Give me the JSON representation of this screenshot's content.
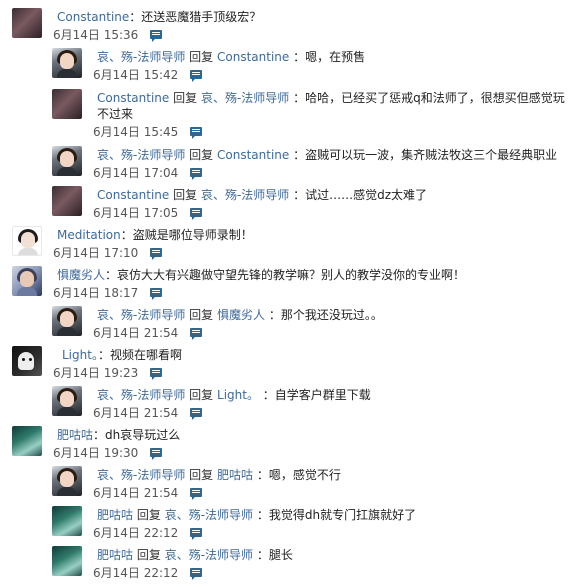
{
  "comments": [
    {
      "id": 0,
      "avatar": "constantine-avatar",
      "author": "Constantine",
      "reply_word": "",
      "reply_to": "",
      "text": "：还送恶魔猎手顶级宏？",
      "time": "6月14日 15:36"
    },
    {
      "id": 1,
      "avatar": "ai-yin-avatar",
      "author": "哀、殇-法师导师",
      "reply_word": "回复",
      "reply_to": "Constantine",
      "text": "：嗯，在预售",
      "time": "6月14日 15:42"
    },
    {
      "id": 2,
      "avatar": "constantine-avatar",
      "author": "Constantine",
      "reply_word": "回复",
      "reply_to": "哀、殇-法师导师",
      "text": "：哈哈，已经买了惩戒q和法师了，很想买但感觉玩不过来",
      "time": "6月14日 15:45"
    },
    {
      "id": 3,
      "avatar": "ai-yin-avatar",
      "author": "哀、殇-法师导师",
      "reply_word": "回复",
      "reply_to": "Constantine",
      "text": "：盗贼可以玩一波，集齐贼法牧这三个最经典职业",
      "time": "6月14日 17:04"
    },
    {
      "id": 4,
      "avatar": "constantine-avatar",
      "author": "Constantine",
      "reply_word": "回复",
      "reply_to": "哀、殇-法师导师",
      "text": "：试过……感觉dz太难了",
      "time": "6月14日 17:05"
    },
    {
      "id": 5,
      "avatar": "meditation-avatar",
      "author": "Meditation",
      "reply_word": "",
      "reply_to": "",
      "text": "：盗贼是哪位导师录制！",
      "time": "6月14日 17:10"
    },
    {
      "id": 6,
      "avatar": "jumo-avatar",
      "author": "惧魔劣人",
      "reply_word": "",
      "reply_to": "",
      "text": "：哀仿大大有兴趣做守望先锋的教学嘛？别人的教学没你的专业啊！",
      "time": "6月14日 18:17"
    },
    {
      "id": 7,
      "avatar": "ai-yin-avatar",
      "author": "哀、殇-法师导师",
      "reply_word": "回复",
      "reply_to": "惧魔劣人",
      "text": "：那个我还没玩过。。",
      "time": "6月14日 21:54"
    },
    {
      "id": 8,
      "avatar": "light-avatar",
      "author": "Light。",
      "reply_word": "",
      "reply_to": "",
      "text": "：视频在哪看啊",
      "time": "6月14日 19:23"
    },
    {
      "id": 9,
      "avatar": "ai-yin-avatar",
      "author": "哀、殇-法师导师",
      "reply_word": "回复",
      "reply_to": "Light。",
      "text": "：自学客户群里下载",
      "time": "6月14日 21:54"
    },
    {
      "id": 10,
      "avatar": "feigugu-avatar",
      "author": "肥咕咕",
      "reply_word": "",
      "reply_to": "",
      "text": "：dh哀导玩过么",
      "time": "6月14日 19:30"
    },
    {
      "id": 11,
      "avatar": "ai-yin-avatar",
      "author": "哀、殇-法师导师",
      "reply_word": "回复",
      "reply_to": "肥咕咕",
      "text": "：嗯，感觉不行",
      "time": "6月14日 21:54"
    },
    {
      "id": 12,
      "avatar": "feigugu-avatar",
      "author": "肥咕咕",
      "reply_word": "回复",
      "reply_to": "哀、殇-法师导师",
      "text": "：我觉得dh就专门扛旗就好了",
      "time": "6月14日 22:12"
    },
    {
      "id": 13,
      "avatar": "feigugu-avatar",
      "author": "肥咕咕",
      "reply_word": "回复",
      "reply_to": "哀、殇-法师导师",
      "text": "：腿长",
      "time": "6月14日 22:12"
    }
  ],
  "icons": {
    "reply": "reply-chat-icon"
  },
  "colors": {
    "username": "#3d6a99",
    "reply_icon": "#2f6690"
  }
}
